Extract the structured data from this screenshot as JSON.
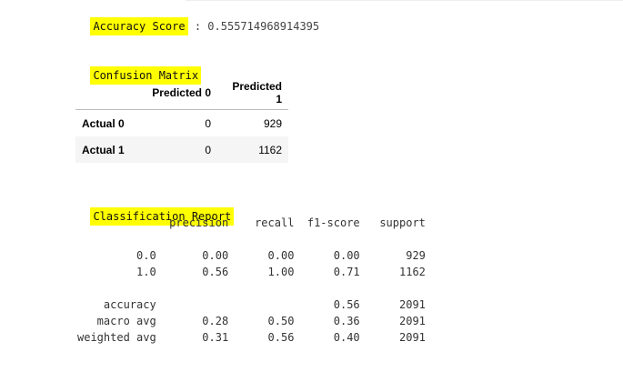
{
  "accuracy": {
    "label": "Accuracy Score",
    "separator": " : ",
    "value": "0.555714968914395"
  },
  "confusion_matrix": {
    "title": "Confusion Matrix",
    "columns": [
      "Predicted 0",
      "Predicted 1"
    ],
    "rows": [
      {
        "label": "Actual 0",
        "values": [
          "0",
          "929"
        ]
      },
      {
        "label": "Actual 1",
        "values": [
          "0",
          "1162"
        ]
      }
    ]
  },
  "classification_report": {
    "title": "Classification Report",
    "lines": [
      "              precision    recall  f1-score   support",
      "",
      "         0.0       0.00      0.00      0.00       929",
      "         1.0       0.56      1.00      0.71      1162",
      "",
      "    accuracy                           0.56      2091",
      "   macro avg       0.28      0.50      0.36      2091",
      "weighted avg       0.31      0.56      0.40      2091"
    ]
  },
  "colors": {
    "highlight": "#ffff00",
    "text": "#333333",
    "stripe": "#f5f5f5"
  }
}
